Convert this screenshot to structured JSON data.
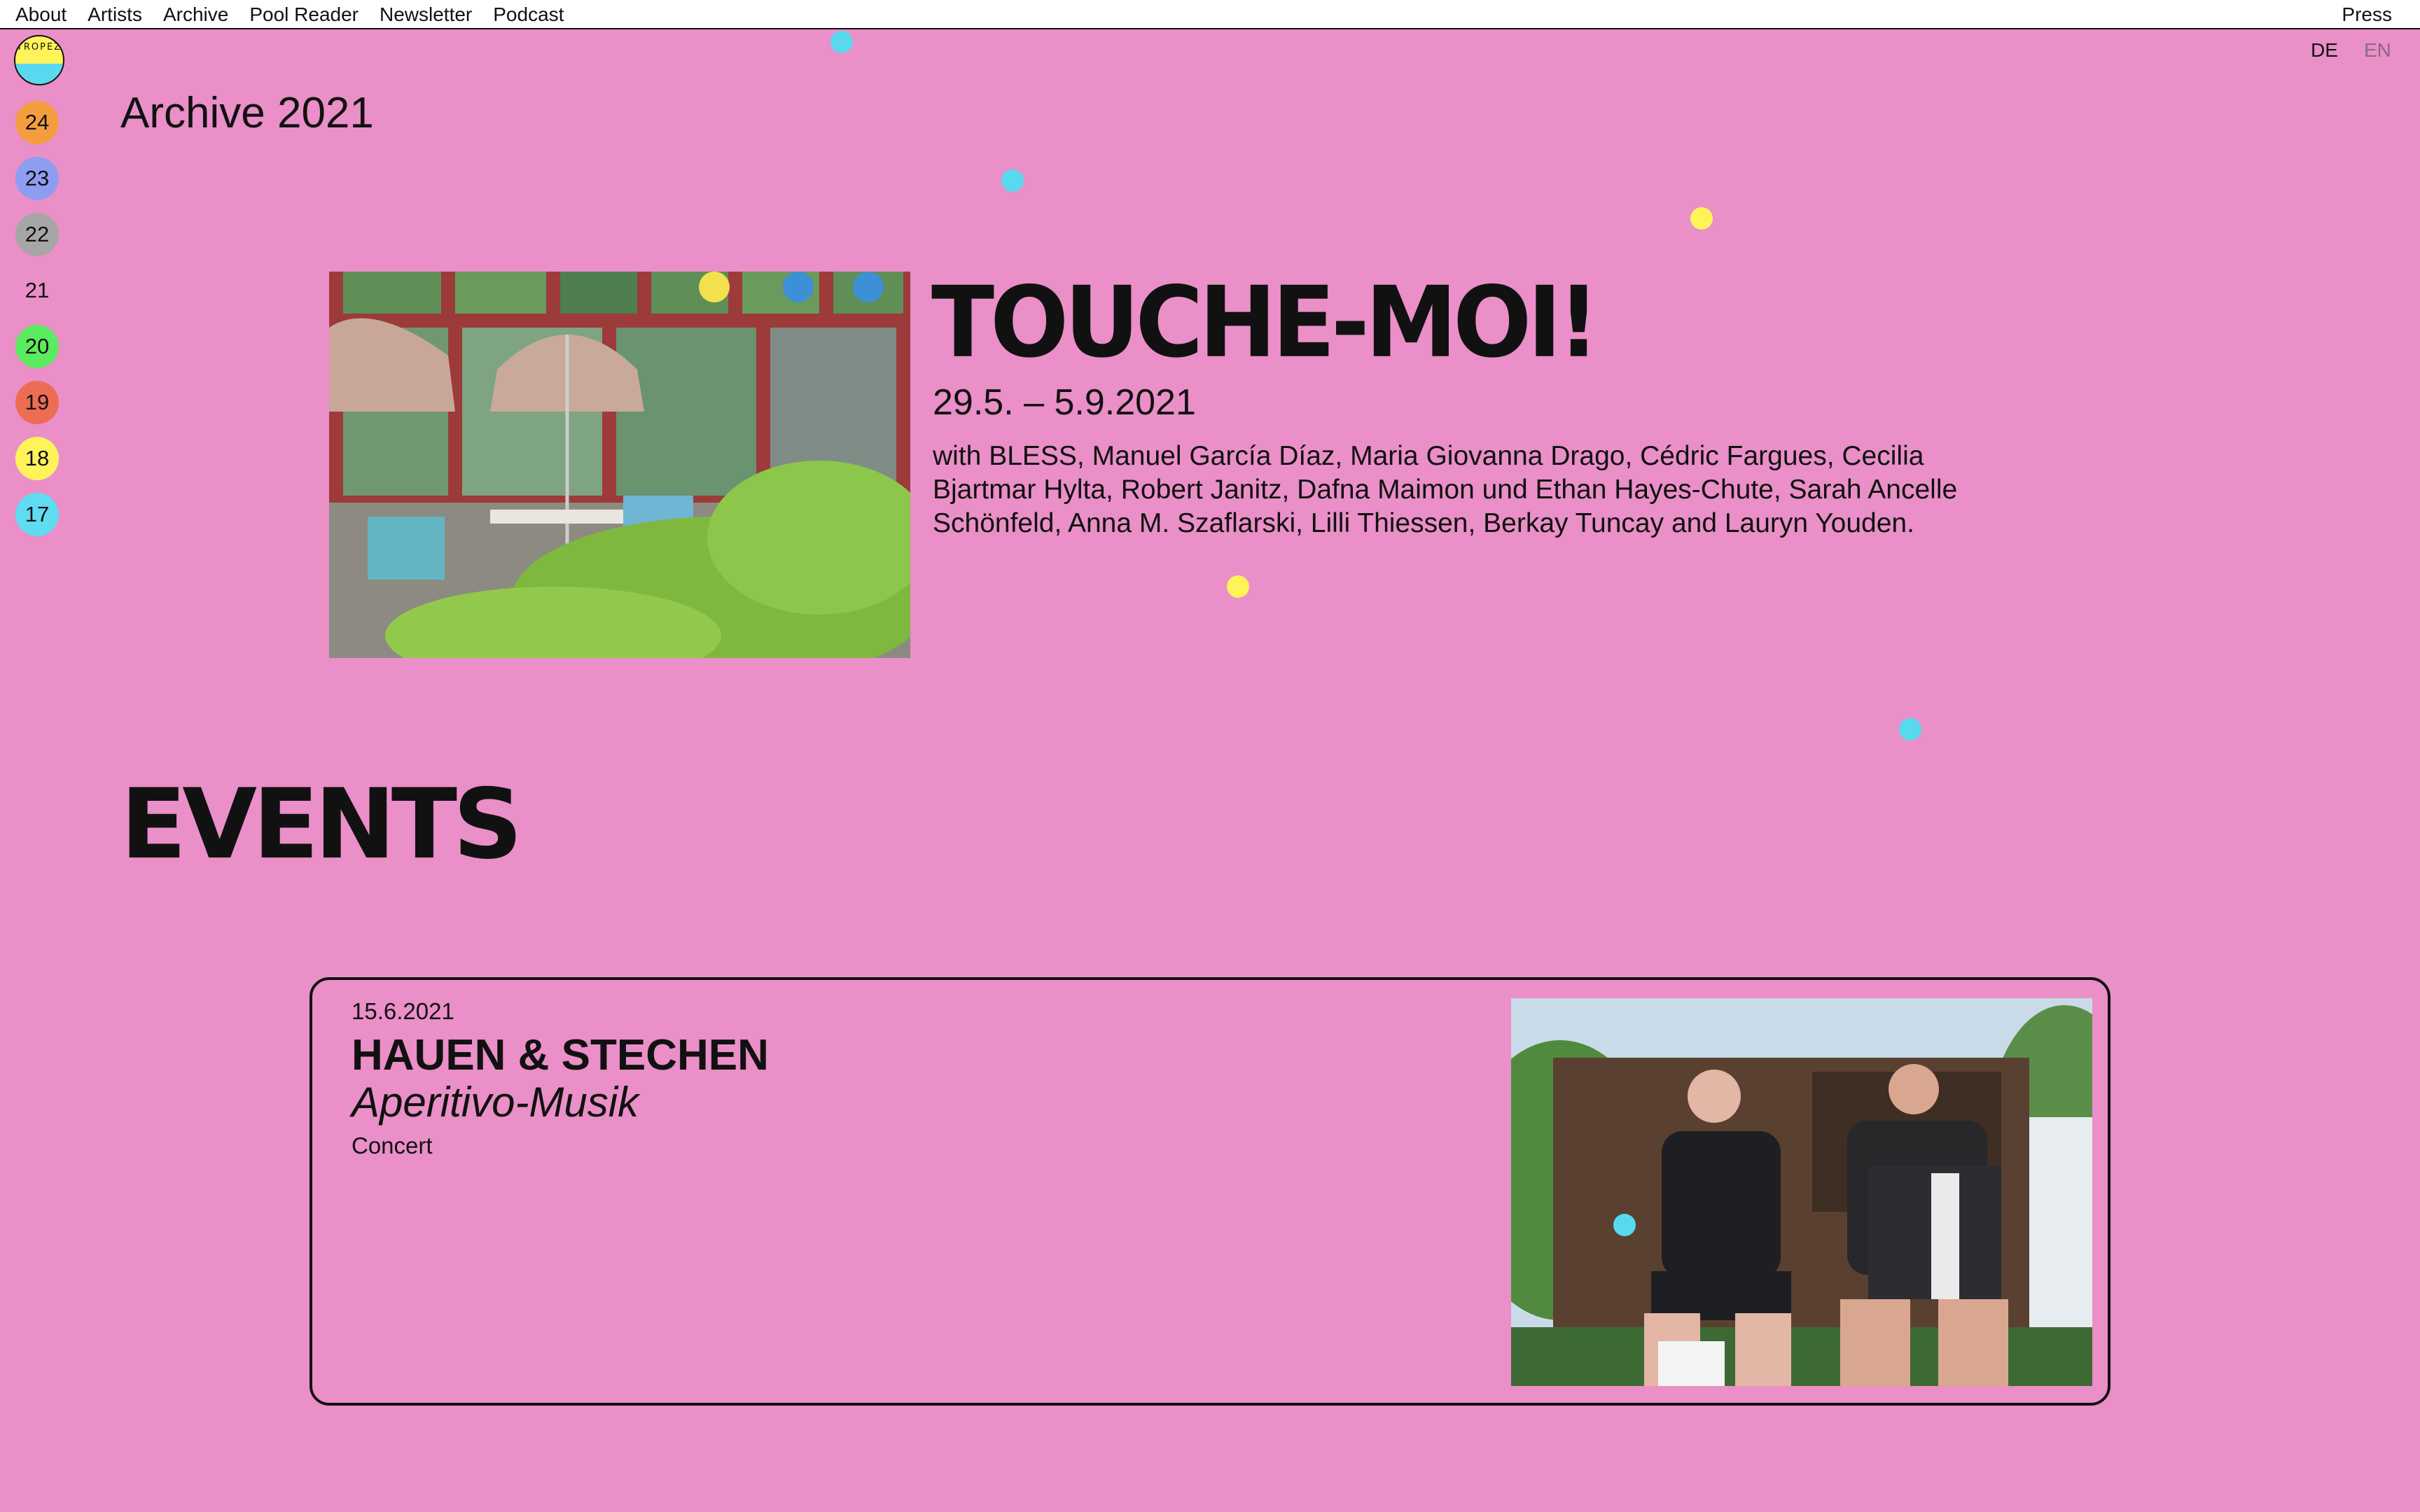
{
  "nav": {
    "items": [
      "About",
      "Artists",
      "Archive",
      "Pool Reader",
      "Newsletter",
      "Podcast"
    ],
    "press": "Press"
  },
  "logo": {
    "letters": "TROPEZ"
  },
  "years": [
    {
      "label": "24",
      "color": "#f49d3f"
    },
    {
      "label": "23",
      "color": "#8e9df2"
    },
    {
      "label": "22",
      "color": "#a6a6a6"
    },
    {
      "label": "21",
      "color": ""
    },
    {
      "label": "20",
      "color": "#5cea5e"
    },
    {
      "label": "19",
      "color": "#ec6d54"
    },
    {
      "label": "18",
      "color": "#fff35a"
    },
    {
      "label": "17",
      "color": "#5fdcf2"
    }
  ],
  "lang": {
    "de": "DE",
    "en": "EN"
  },
  "page_title": "Archive 2021",
  "exhibition": {
    "title": "TOUCHE-MOI!",
    "dates": "29.5. – 5.9.2021",
    "description": "with BLESS, Manuel García Díaz, Maria Giovanna Drago, Cédric Fargues, Cecilia Bjartmar Hylta, Robert Janitz, Dafna Maimon und Ethan Hayes-Chute, Sarah Ancelle Schönfeld, Anna M. Szaflarski, Lilli Thiessen, Berkay Tuncay and Lauryn Youden."
  },
  "events_heading": "EVENTS",
  "event": {
    "date": "15.6.2021",
    "name": "HAUEN & STECHEN",
    "subtitle": "Aperitivo-Musik",
    "type": "Concert"
  },
  "colors": {
    "background": "#ea8fc7",
    "dot_cyan": "#59d9ef",
    "dot_yellow": "#fff35a"
  }
}
